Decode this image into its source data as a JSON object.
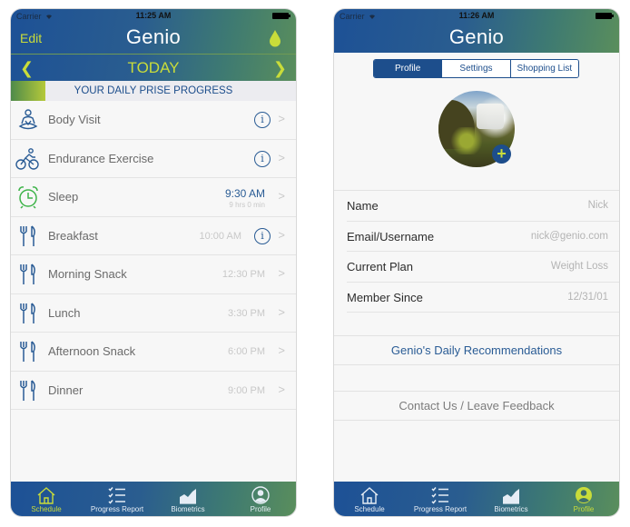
{
  "colors": {
    "brand_blue": "#1d4e8c",
    "accent_lime": "#c9dc3a",
    "muted_text": "#c8c8c8"
  },
  "left_screen": {
    "status": {
      "carrier": "Carrier",
      "time": "11:25 AM"
    },
    "nav": {
      "edit_label": "Edit",
      "title": "Genio",
      "right_icon": "water-drop-icon"
    },
    "date": {
      "label": "TODAY",
      "prev_icon": "chevron-left-icon",
      "next_icon": "chevron-right-icon"
    },
    "progress": {
      "label": "YOUR DAILY PRISE PROGRESS",
      "fill_fraction": 0.12
    },
    "schedule": [
      {
        "name": "Body Visit",
        "icon": "meditation-icon",
        "time": "",
        "info": true
      },
      {
        "name": "Endurance Exercise",
        "icon": "cycling-icon",
        "time": "",
        "info": true
      },
      {
        "name": "Sleep",
        "icon": "alarm-clock-icon",
        "time": "9:30 AM",
        "sub": "9 hrs 0 min",
        "info": false
      },
      {
        "name": "Breakfast",
        "icon": "fork-knife-icon",
        "time": "10:00 AM",
        "info": true
      },
      {
        "name": "Morning Snack",
        "icon": "fork-knife-icon",
        "time": "12:30 PM",
        "info": false
      },
      {
        "name": "Lunch",
        "icon": "fork-knife-icon",
        "time": "3:30 PM",
        "info": false
      },
      {
        "name": "Afternoon Snack",
        "icon": "fork-knife-icon",
        "time": "6:00 PM",
        "info": false
      },
      {
        "name": "Dinner",
        "icon": "fork-knife-icon",
        "time": "9:00 PM",
        "info": false
      }
    ],
    "info_glyph": "i",
    "arrow_glyph": ">"
  },
  "right_screen": {
    "status": {
      "carrier": "Carrier",
      "time": "11:26 AM"
    },
    "nav": {
      "title": "Genio"
    },
    "segments": [
      "Profile",
      "Settings",
      "Shopping List"
    ],
    "selected_segment": "Profile",
    "add_photo_glyph": "+",
    "profile": [
      {
        "label": "Name",
        "value": "Nick"
      },
      {
        "label": "Email/Username",
        "value": "nick@genio.com"
      },
      {
        "label": "Current Plan",
        "value": "Weight Loss"
      },
      {
        "label": "Member Since",
        "value": "12/31/01"
      }
    ],
    "recommendations_link": "Genio's Daily Recommendations",
    "contact_link": "Contact Us / Leave Feedback"
  },
  "tabbar": {
    "tabs": [
      {
        "label": "Schedule",
        "icon": "house-icon"
      },
      {
        "label": "Progress Report",
        "icon": "checklist-icon"
      },
      {
        "label": "Biometrics",
        "icon": "chart-icon"
      },
      {
        "label": "Profile",
        "icon": "person-icon"
      }
    ],
    "left_active": "Schedule",
    "right_active": "Profile"
  }
}
